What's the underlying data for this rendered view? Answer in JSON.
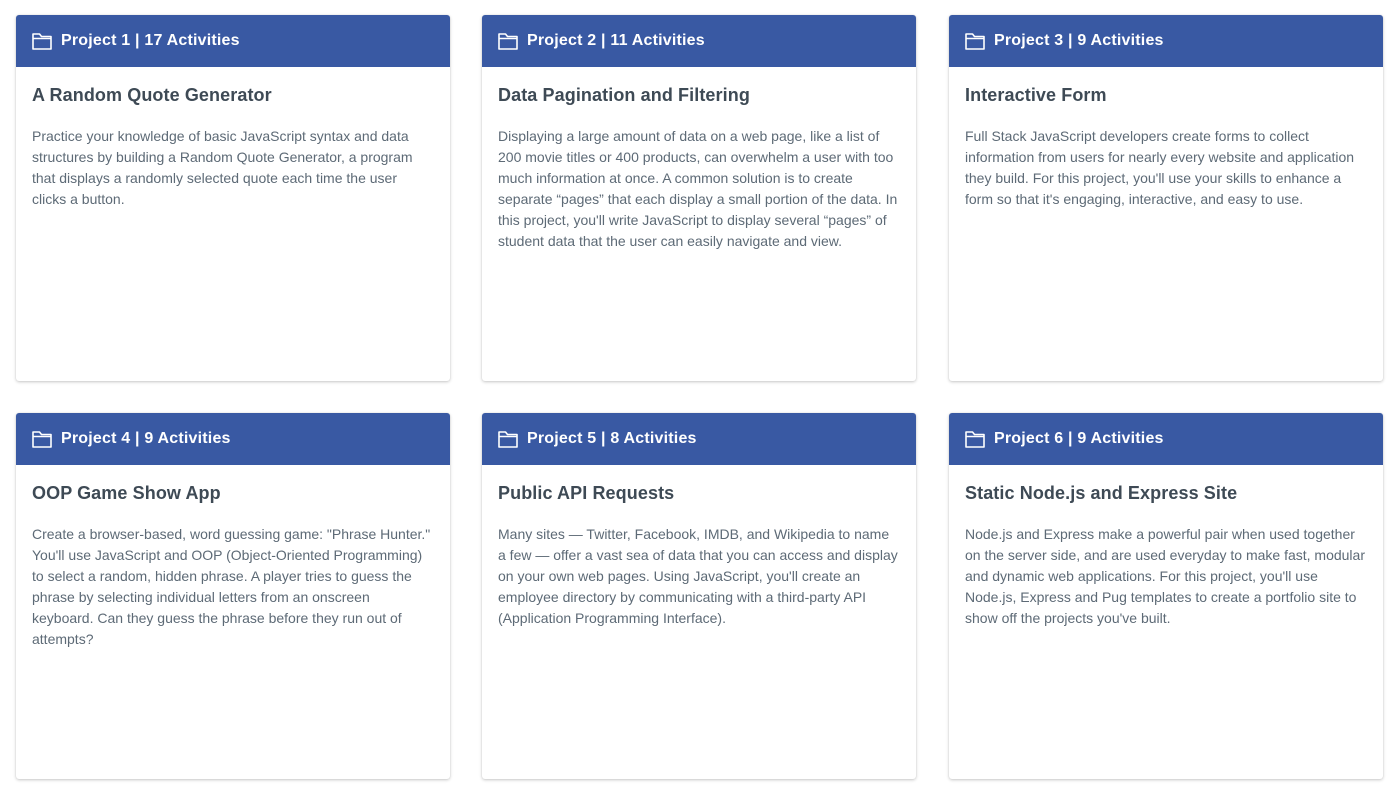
{
  "projects": [
    {
      "header": "Project 1 | 17 Activities",
      "icon": "folder-icon",
      "title": "A Random Quote Generator",
      "description": "Practice your knowledge of basic JavaScript syntax and data structures by building a Random Quote Generator, a program that displays a randomly selected quote each time the user clicks a button."
    },
    {
      "header": "Project 2 | 11 Activities",
      "icon": "folder-icon",
      "title": "Data Pagination and Filtering",
      "description": "Displaying a large amount of data on a web page, like a list of 200 movie titles or 400 products, can overwhelm a user with too much information at once. A common solution is to create separate “pages” that each display a small portion of the data. In this project, you'll write JavaScript to display several “pages” of student data that the user can easily navigate and view."
    },
    {
      "header": "Project 3 | 9 Activities",
      "icon": "folder-icon",
      "title": "Interactive Form",
      "description": "Full Stack JavaScript developers create forms to collect information from users for nearly every website and application they build. For this project, you'll use your skills to enhance a form so that it's engaging, interactive, and easy to use."
    },
    {
      "header": "Project 4 | 9 Activities",
      "icon": "folder-icon",
      "title": "OOP Game Show App",
      "description": "Create a browser-based, word guessing game: \"Phrase Hunter.\" You'll use JavaScript and OOP (Object-Oriented Programming) to select a random, hidden phrase. A player tries to guess the phrase by selecting individual letters from an onscreen keyboard. Can they guess the phrase before they run out of attempts?"
    },
    {
      "header": "Project 5 | 8 Activities",
      "icon": "folder-icon",
      "title": "Public API Requests",
      "description": "Many sites — Twitter, Facebook, IMDB, and Wikipedia to name a few — offer a vast sea of data that you can access and display on your own web pages. Using JavaScript, you'll create an employee directory by communicating with a third-party API (Application Programming Interface)."
    },
    {
      "header": "Project 6 | 9 Activities",
      "icon": "folder-icon",
      "title": "Static Node.js and Express Site",
      "description": "Node.js and Express make a powerful pair when used together on the server side, and are used everyday to make fast, modular and dynamic web applications. For this project, you'll use Node.js, Express and Pug templates to create a portfolio site to show off the projects you've built."
    }
  ],
  "colors": {
    "header_bg": "#3959a3",
    "header_text": "#ffffff",
    "title_text": "#3e4a55",
    "body_text": "#5d6a76"
  }
}
